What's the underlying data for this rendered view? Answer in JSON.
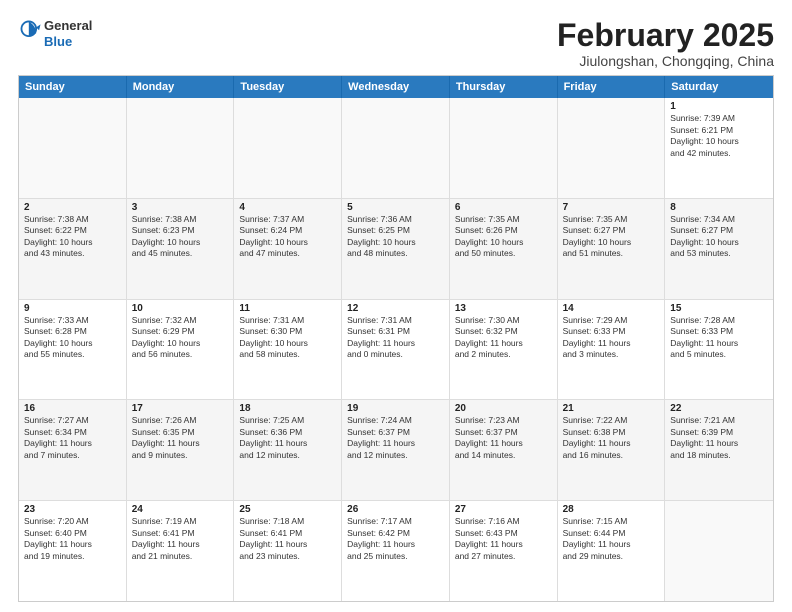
{
  "header": {
    "logo_general": "General",
    "logo_blue": "Blue",
    "month_title": "February 2025",
    "location": "Jiulongshan, Chongqing, China"
  },
  "weekdays": [
    "Sunday",
    "Monday",
    "Tuesday",
    "Wednesday",
    "Thursday",
    "Friday",
    "Saturday"
  ],
  "weeks": [
    [
      {
        "day": "",
        "text": ""
      },
      {
        "day": "",
        "text": ""
      },
      {
        "day": "",
        "text": ""
      },
      {
        "day": "",
        "text": ""
      },
      {
        "day": "",
        "text": ""
      },
      {
        "day": "",
        "text": ""
      },
      {
        "day": "1",
        "text": "Sunrise: 7:39 AM\nSunset: 6:21 PM\nDaylight: 10 hours\nand 42 minutes."
      }
    ],
    [
      {
        "day": "2",
        "text": "Sunrise: 7:38 AM\nSunset: 6:22 PM\nDaylight: 10 hours\nand 43 minutes."
      },
      {
        "day": "3",
        "text": "Sunrise: 7:38 AM\nSunset: 6:23 PM\nDaylight: 10 hours\nand 45 minutes."
      },
      {
        "day": "4",
        "text": "Sunrise: 7:37 AM\nSunset: 6:24 PM\nDaylight: 10 hours\nand 47 minutes."
      },
      {
        "day": "5",
        "text": "Sunrise: 7:36 AM\nSunset: 6:25 PM\nDaylight: 10 hours\nand 48 minutes."
      },
      {
        "day": "6",
        "text": "Sunrise: 7:35 AM\nSunset: 6:26 PM\nDaylight: 10 hours\nand 50 minutes."
      },
      {
        "day": "7",
        "text": "Sunrise: 7:35 AM\nSunset: 6:27 PM\nDaylight: 10 hours\nand 51 minutes."
      },
      {
        "day": "8",
        "text": "Sunrise: 7:34 AM\nSunset: 6:27 PM\nDaylight: 10 hours\nand 53 minutes."
      }
    ],
    [
      {
        "day": "9",
        "text": "Sunrise: 7:33 AM\nSunset: 6:28 PM\nDaylight: 10 hours\nand 55 minutes."
      },
      {
        "day": "10",
        "text": "Sunrise: 7:32 AM\nSunset: 6:29 PM\nDaylight: 10 hours\nand 56 minutes."
      },
      {
        "day": "11",
        "text": "Sunrise: 7:31 AM\nSunset: 6:30 PM\nDaylight: 10 hours\nand 58 minutes."
      },
      {
        "day": "12",
        "text": "Sunrise: 7:31 AM\nSunset: 6:31 PM\nDaylight: 11 hours\nand 0 minutes."
      },
      {
        "day": "13",
        "text": "Sunrise: 7:30 AM\nSunset: 6:32 PM\nDaylight: 11 hours\nand 2 minutes."
      },
      {
        "day": "14",
        "text": "Sunrise: 7:29 AM\nSunset: 6:33 PM\nDaylight: 11 hours\nand 3 minutes."
      },
      {
        "day": "15",
        "text": "Sunrise: 7:28 AM\nSunset: 6:33 PM\nDaylight: 11 hours\nand 5 minutes."
      }
    ],
    [
      {
        "day": "16",
        "text": "Sunrise: 7:27 AM\nSunset: 6:34 PM\nDaylight: 11 hours\nand 7 minutes."
      },
      {
        "day": "17",
        "text": "Sunrise: 7:26 AM\nSunset: 6:35 PM\nDaylight: 11 hours\nand 9 minutes."
      },
      {
        "day": "18",
        "text": "Sunrise: 7:25 AM\nSunset: 6:36 PM\nDaylight: 11 hours\nand 12 minutes."
      },
      {
        "day": "19",
        "text": "Sunrise: 7:24 AM\nSunset: 6:37 PM\nDaylight: 11 hours\nand 12 minutes."
      },
      {
        "day": "20",
        "text": "Sunrise: 7:23 AM\nSunset: 6:37 PM\nDaylight: 11 hours\nand 14 minutes."
      },
      {
        "day": "21",
        "text": "Sunrise: 7:22 AM\nSunset: 6:38 PM\nDaylight: 11 hours\nand 16 minutes."
      },
      {
        "day": "22",
        "text": "Sunrise: 7:21 AM\nSunset: 6:39 PM\nDaylight: 11 hours\nand 18 minutes."
      }
    ],
    [
      {
        "day": "23",
        "text": "Sunrise: 7:20 AM\nSunset: 6:40 PM\nDaylight: 11 hours\nand 19 minutes."
      },
      {
        "day": "24",
        "text": "Sunrise: 7:19 AM\nSunset: 6:41 PM\nDaylight: 11 hours\nand 21 minutes."
      },
      {
        "day": "25",
        "text": "Sunrise: 7:18 AM\nSunset: 6:41 PM\nDaylight: 11 hours\nand 23 minutes."
      },
      {
        "day": "26",
        "text": "Sunrise: 7:17 AM\nSunset: 6:42 PM\nDaylight: 11 hours\nand 25 minutes."
      },
      {
        "day": "27",
        "text": "Sunrise: 7:16 AM\nSunset: 6:43 PM\nDaylight: 11 hours\nand 27 minutes."
      },
      {
        "day": "28",
        "text": "Sunrise: 7:15 AM\nSunset: 6:44 PM\nDaylight: 11 hours\nand 29 minutes."
      },
      {
        "day": "",
        "text": ""
      }
    ]
  ]
}
